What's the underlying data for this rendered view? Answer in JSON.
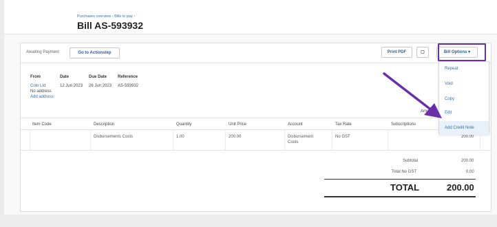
{
  "header": {
    "breadcrumb": "Purchases overview › Bills to pay ›",
    "title": "Bill AS-593932"
  },
  "actionbar": {
    "status": "Awaiting Payment",
    "actionstep_label": "Go to Actionstep",
    "print_label": "Print PDF",
    "options_label": "Bill Options",
    "options_caret": "▾",
    "doc_icon": "▢"
  },
  "options_menu": {
    "items": [
      {
        "label": "Repeat"
      },
      {
        "label": "Void"
      },
      {
        "label": "Copy"
      },
      {
        "label": "Edit"
      },
      {
        "label": "Add Credit Note"
      }
    ]
  },
  "bill_meta": {
    "from_label": "From",
    "from_value": "Colo Ltd",
    "no_address": "No address",
    "add_address": "Add address",
    "date_label": "Date",
    "date_value": "12 Jun 2023",
    "due_label": "Due Date",
    "due_value": "26 Jun 2023",
    "ref_label": "Reference",
    "ref_value": "AS-593932",
    "amounts_label": "Amou"
  },
  "line_items": {
    "columns": [
      "Item Code",
      "Description",
      "Quantity",
      "Unit Price",
      "Account",
      "Tax Rate",
      "Subscriptions"
    ],
    "rows": [
      {
        "item_code": "",
        "description": "Disbursements Costs",
        "quantity": "1.00",
        "unit_price": "200.00",
        "account": "Disbursement Costs",
        "tax_rate": "No GST",
        "subscriptions": "",
        "amount": "200.00"
      }
    ]
  },
  "totals": {
    "subtotal_label": "Subtotal",
    "subtotal_value": "200.00",
    "tax_label": "Total No GST",
    "tax_value": "0.00",
    "total_label": "TOTAL",
    "total_value": "200.00"
  },
  "colors": {
    "annotation": "#6a2ea8",
    "link": "#3a6ea5"
  }
}
